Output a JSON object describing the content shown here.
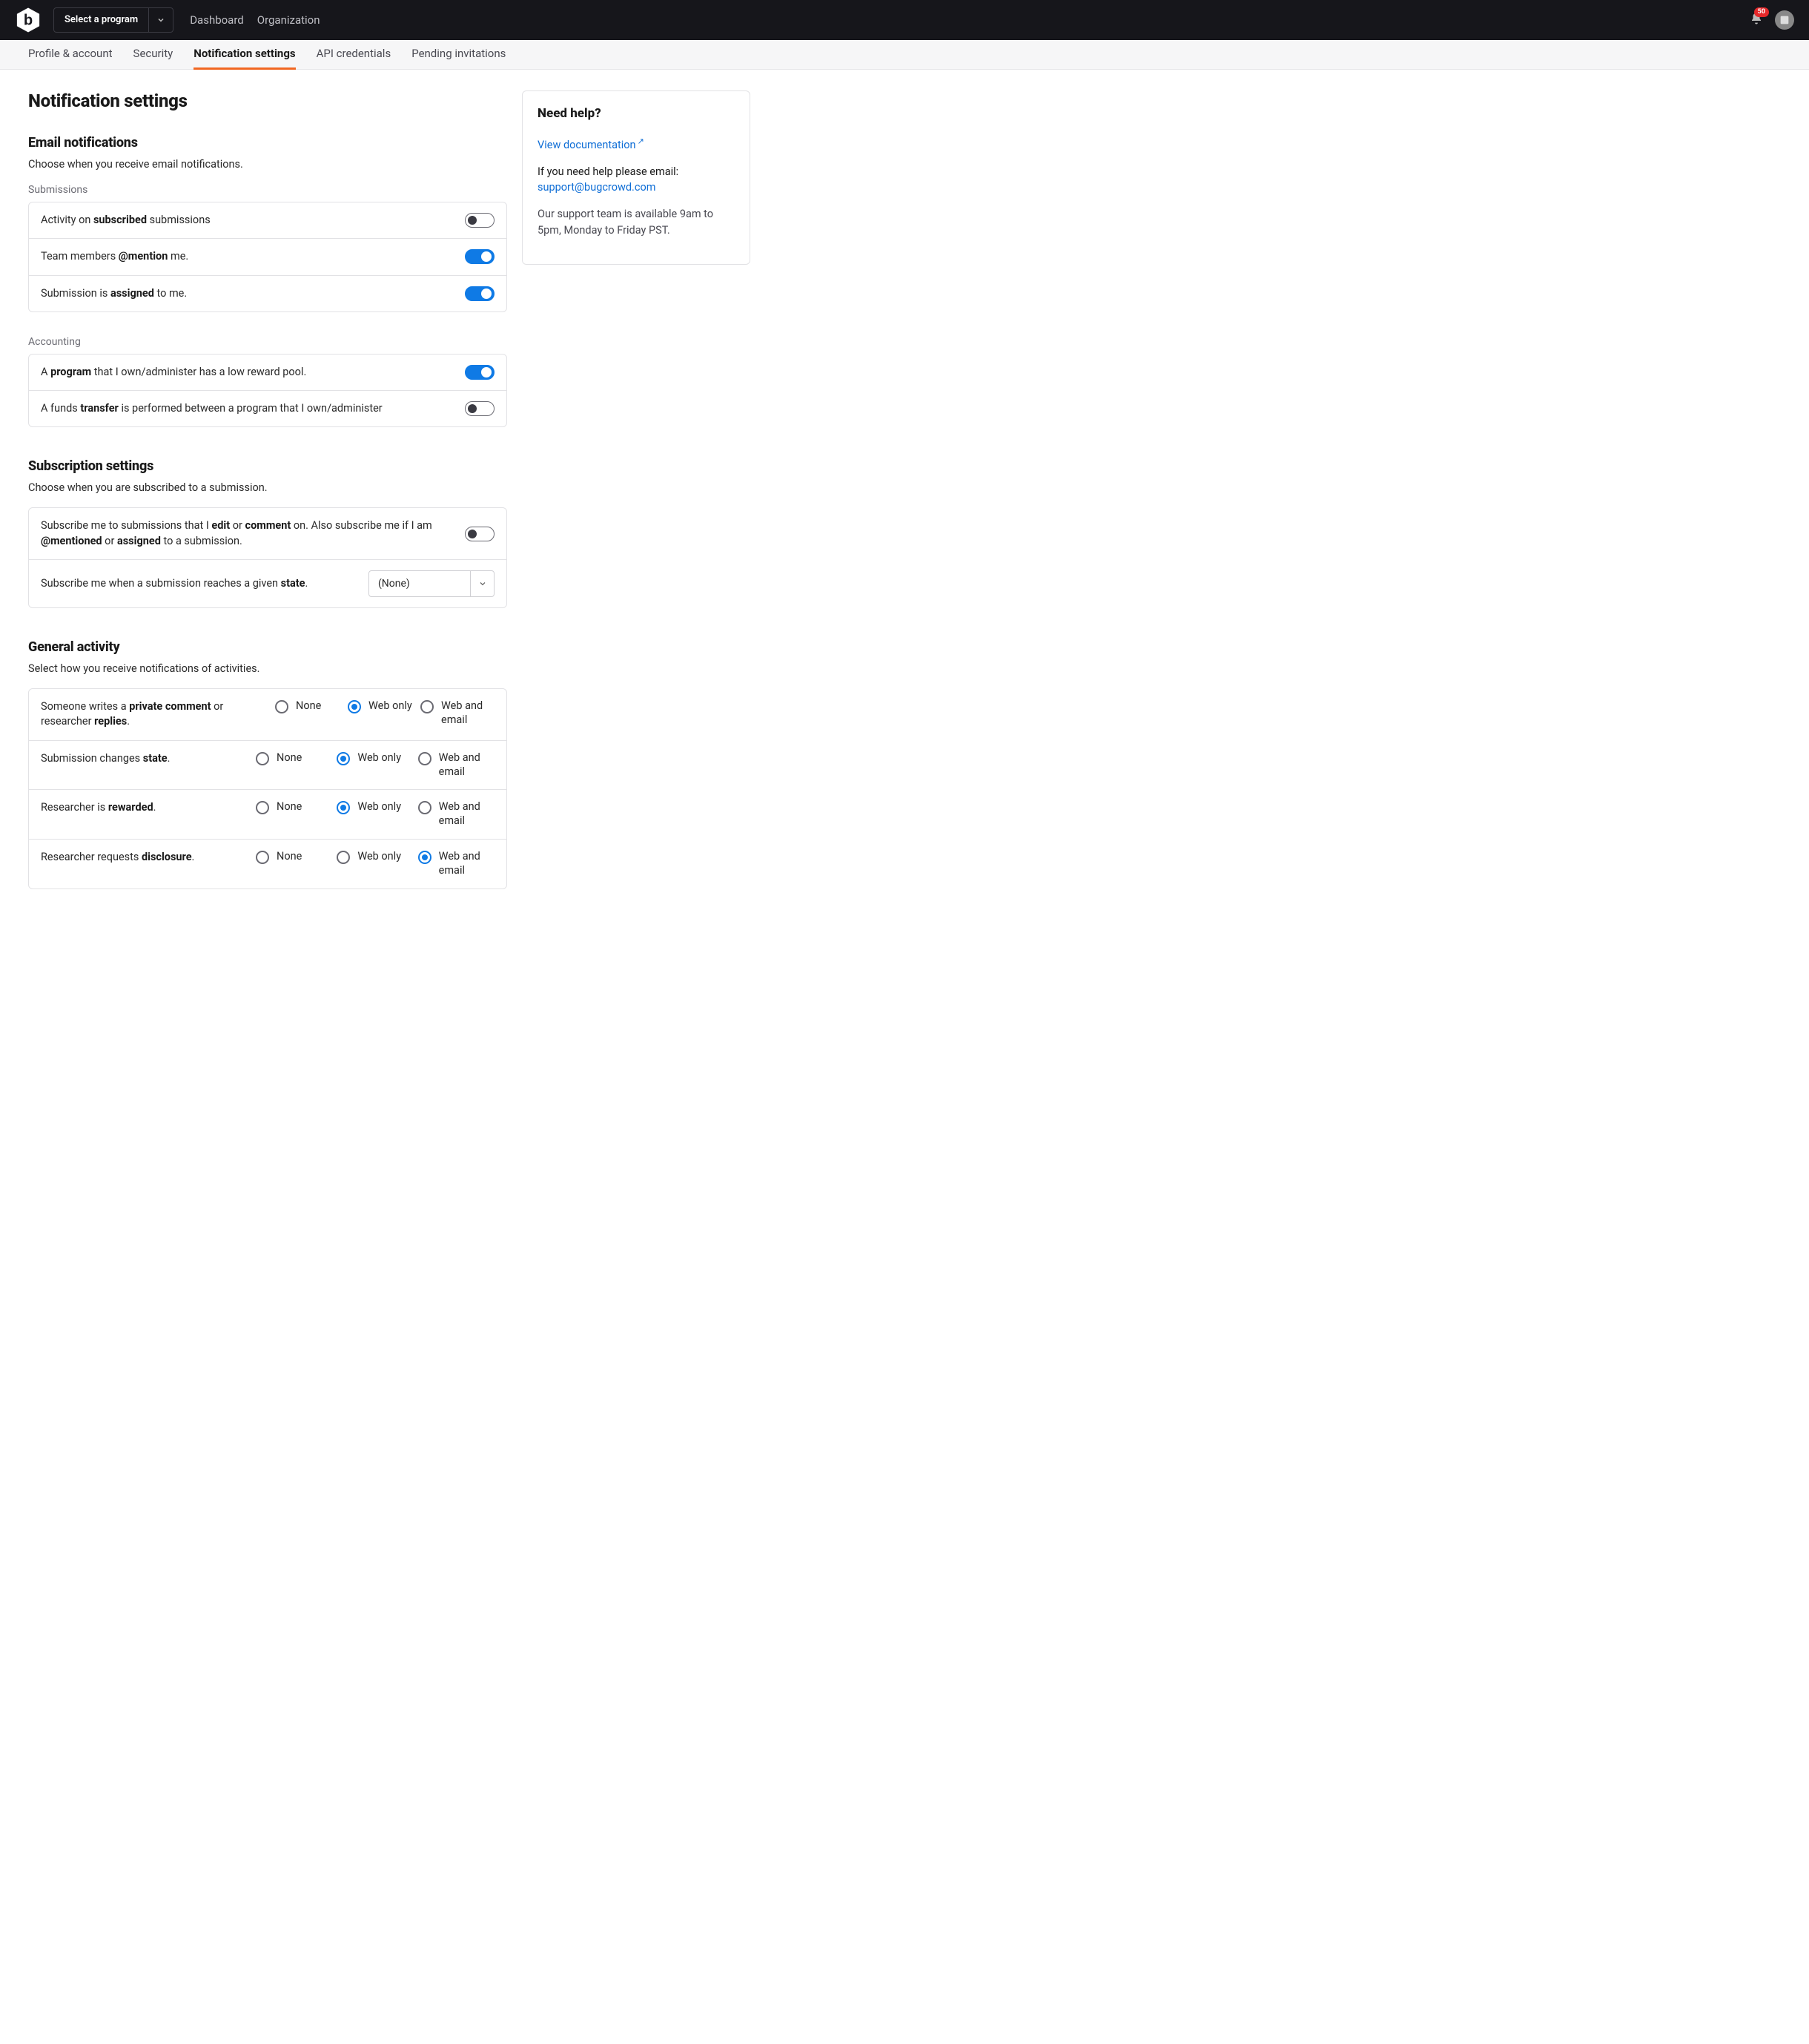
{
  "topnav": {
    "program_label": "Select a program",
    "links": [
      "Dashboard",
      "Organization"
    ],
    "notification_count": "50"
  },
  "subnav": {
    "tabs": [
      "Profile & account",
      "Security",
      "Notification settings",
      "API credentials",
      "Pending invitations"
    ],
    "active_index": 2
  },
  "page": {
    "title": "Notification settings"
  },
  "email": {
    "title": "Email notifications",
    "desc": "Choose when you receive email notifications.",
    "group_submissions": "Submissions",
    "row_activity_pre": "Activity on ",
    "row_activity_b": "subscribed",
    "row_activity_post": " submissions",
    "row_mention_pre": "Team members ",
    "row_mention_b": "@mention",
    "row_mention_post": " me.",
    "row_assigned_pre": "Submission is ",
    "row_assigned_b": "assigned",
    "row_assigned_post": " to me.",
    "group_accounting": "Accounting",
    "row_program_pre": "A ",
    "row_program_b": "program",
    "row_program_post": " that I own/administer has a low reward pool.",
    "row_transfer_pre": "A funds ",
    "row_transfer_b": "transfer",
    "row_transfer_post": " is performed between a program that I own/administer"
  },
  "subscription": {
    "title": "Subscription settings",
    "desc": "Choose when you are subscribed to a submission.",
    "row1_parts": [
      "Subscribe me to submissions that I ",
      "edit",
      " or ",
      "comment",
      " on. Also subscribe me if I am ",
      "@mentioned",
      " or ",
      "assigned",
      " to a submission."
    ],
    "row2_pre": "Subscribe me when a submission reaches a given ",
    "row2_b": "state",
    "row2_post": ".",
    "state_value": "(None)"
  },
  "activity": {
    "title": "General activity",
    "desc": "Select how you receive notifications of activities.",
    "options": [
      "None",
      "Web only",
      "Web and email"
    ],
    "rows": [
      {
        "parts": [
          "Someone writes a ",
          "private comment",
          " or researcher ",
          "replies",
          "."
        ],
        "selected": 1
      },
      {
        "parts": [
          "Submission changes ",
          "state",
          "."
        ],
        "selected": 1
      },
      {
        "parts": [
          "Researcher is ",
          "rewarded",
          "."
        ],
        "selected": 1
      },
      {
        "parts": [
          "Researcher requests ",
          "disclosure",
          "."
        ],
        "selected": 2
      }
    ]
  },
  "help": {
    "title": "Need help?",
    "doc_link": "View documentation",
    "email_pre": "If you need help please email:",
    "email": "support@bugcrowd.com",
    "hours": "Our support team is available 9am to 5pm, Monday to Friday PST."
  }
}
